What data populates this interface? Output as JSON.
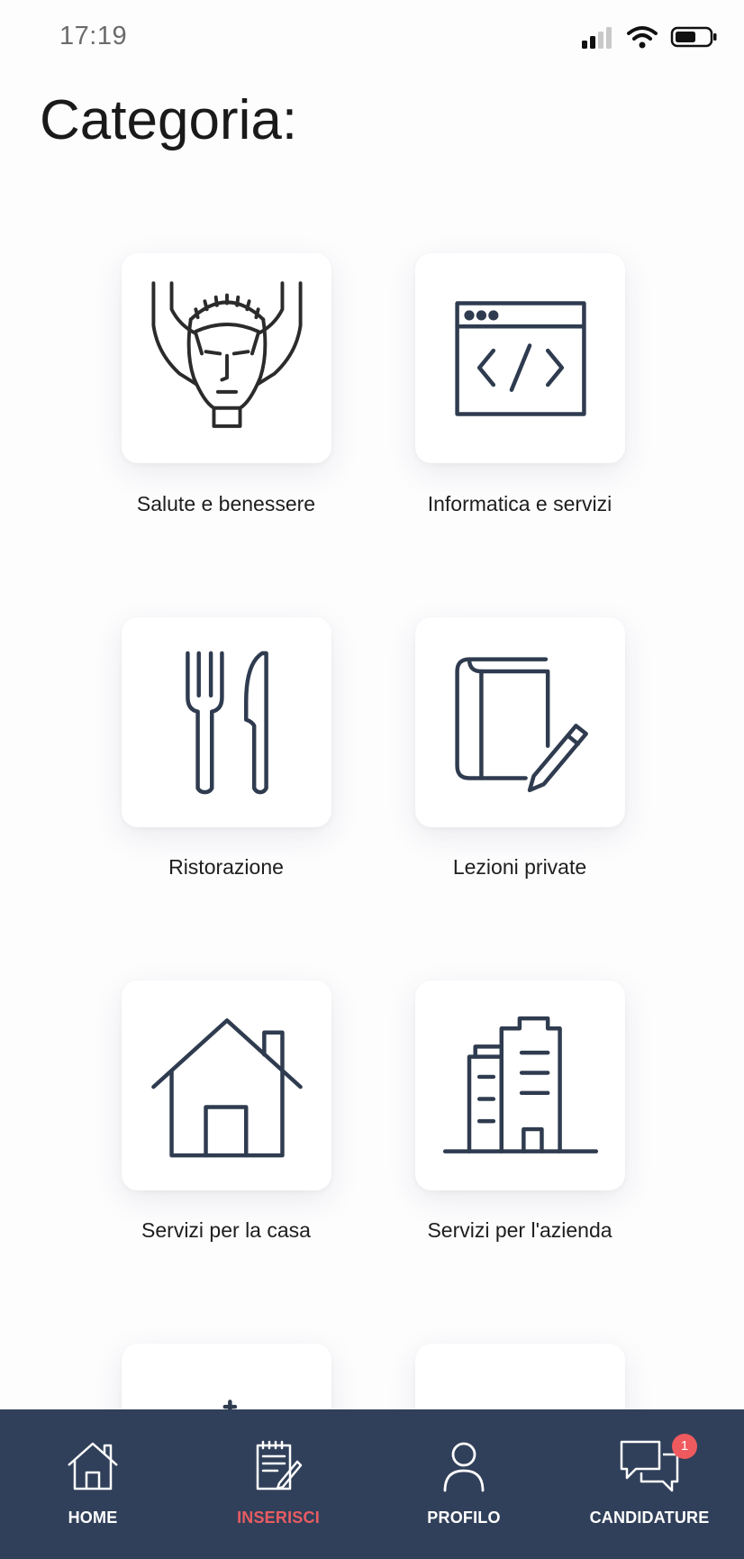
{
  "status_bar": {
    "time": "17:19"
  },
  "page": {
    "title": "Categoria:"
  },
  "categories": [
    {
      "label": "Salute e benessere",
      "icon": "face-massage-icon"
    },
    {
      "label": "Informatica e servizi",
      "icon": "code-window-icon"
    },
    {
      "label": "Ristorazione",
      "icon": "fork-knife-icon"
    },
    {
      "label": "Lezioni private",
      "icon": "book-pencil-icon"
    },
    {
      "label": "Servizi per la casa",
      "icon": "house-icon"
    },
    {
      "label": "Servizi per l'azienda",
      "icon": "office-building-icon"
    },
    {
      "label": "",
      "icon": "sparkle-icon"
    },
    {
      "label": "",
      "icon": "partial-icon"
    }
  ],
  "tab_bar": {
    "items": [
      {
        "label": "HOME",
        "icon": "home-icon",
        "active": false
      },
      {
        "label": "INSERISCI",
        "icon": "notepad-pencil-icon",
        "active": true
      },
      {
        "label": "PROFILO",
        "icon": "user-icon",
        "active": false
      },
      {
        "label": "CANDIDATURE",
        "icon": "chat-bubbles-icon",
        "active": false,
        "badge": "1"
      }
    ]
  },
  "colors": {
    "tab_bar_bg": "#31405a",
    "active_tab": "#e85c62",
    "badge": "#ef5a5f",
    "icon_stroke": "#2f3b4f"
  }
}
